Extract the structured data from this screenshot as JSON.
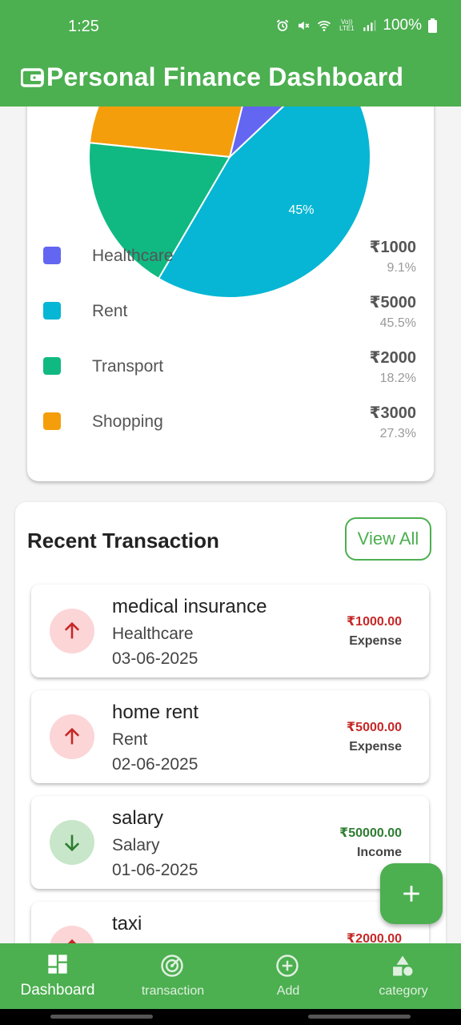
{
  "status_bar": {
    "time": "1:25",
    "lte": "Vo)) LTE1",
    "battery": "100%"
  },
  "app_bar": {
    "title": "Personal Finance Dashboard"
  },
  "chart_data": {
    "type": "pie",
    "slice_labels": [
      "45%"
    ],
    "slices": [
      {
        "label": "Healthcare",
        "value": 1000,
        "percent": 9.1,
        "color": "#6366f1"
      },
      {
        "label": "Rent",
        "value": 5000,
        "percent": 45.5,
        "color": "#06b6d4"
      },
      {
        "label": "Transport",
        "value": 2000,
        "percent": 18.2,
        "color": "#10b981"
      },
      {
        "label": "Shopping",
        "value": 3000,
        "percent": 27.3,
        "color": "#f59e0b"
      }
    ]
  },
  "legend": [
    {
      "name": "Healthcare",
      "amount": "₹1000",
      "percent": "9.1%",
      "color": "#6366f1"
    },
    {
      "name": "Rent",
      "amount": "₹5000",
      "percent": "45.5%",
      "color": "#06b6d4"
    },
    {
      "name": "Transport",
      "amount": "₹2000",
      "percent": "18.2%",
      "color": "#10b981"
    },
    {
      "name": "Shopping",
      "amount": "₹3000",
      "percent": "27.3%",
      "color": "#f59e0b"
    }
  ],
  "recent": {
    "heading": "Recent Transaction",
    "view_all": "View All",
    "transactions": [
      {
        "name": "medical insurance",
        "category": "Healthcare",
        "date": "03-06-2025",
        "amount": "₹1000.00",
        "type": "Expense",
        "icon": "arrow-up-icon"
      },
      {
        "name": "home rent",
        "category": "Rent",
        "date": "02-06-2025",
        "amount": "₹5000.00",
        "type": "Expense",
        "icon": "arrow-up-icon"
      },
      {
        "name": "salary",
        "category": "Salary",
        "date": "01-06-2025",
        "amount": "₹50000.00",
        "type": "Income",
        "icon": "arrow-down-icon"
      },
      {
        "name": "taxi",
        "category": "",
        "date": "",
        "amount": "₹2000.00",
        "type": "",
        "icon": "arrow-up-icon"
      }
    ]
  },
  "bottom_nav": [
    {
      "label": "Dashboard",
      "icon": "dashboard-icon",
      "active": true
    },
    {
      "label": "transaction",
      "icon": "track-changes-icon",
      "active": false
    },
    {
      "label": "Add",
      "icon": "add-circle-icon",
      "active": false
    },
    {
      "label": "category",
      "icon": "category-icon",
      "active": false
    }
  ],
  "colors": {
    "primary": "#4caf50",
    "expense": "#c62828",
    "income": "#2e7d32"
  }
}
